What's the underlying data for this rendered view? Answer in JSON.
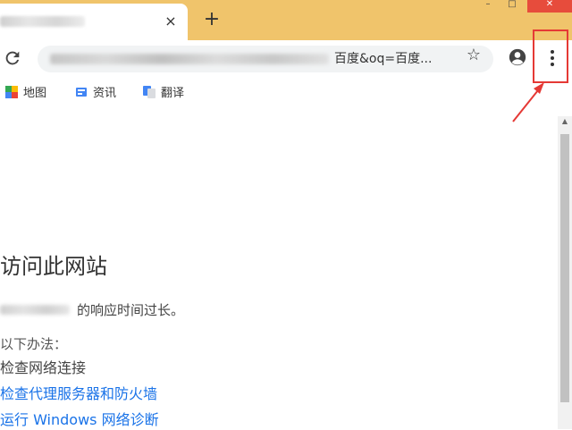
{
  "window": {
    "minimize": "–",
    "maximize": "□",
    "close": "✕"
  },
  "tabs": [
    {
      "close_label": "×"
    }
  ],
  "toolbar": {
    "new_tab_label": "+",
    "url_visible_text": "百度&oq=百度...",
    "reload_icon": "reload-icon",
    "star_icon": "☆",
    "menu_icon": "three-dot-menu-icon"
  },
  "bookmarks": [
    {
      "label": "地图",
      "icon": "maps-icon"
    },
    {
      "label": "资讯",
      "icon": "news-icon"
    },
    {
      "label": "翻译",
      "icon": "translate-icon"
    }
  ],
  "error": {
    "title": "访问此网站",
    "description": "的响应时间过长。",
    "try_heading": "以下办法：",
    "suggestions": [
      "检查网络连接",
      "检查代理服务器和防火墙",
      "运行 Windows 网络诊断"
    ]
  },
  "annotation": {
    "color": "#e53935"
  },
  "colors": {
    "tab_strip": "#f0c46b",
    "link": "#1a73e8"
  }
}
